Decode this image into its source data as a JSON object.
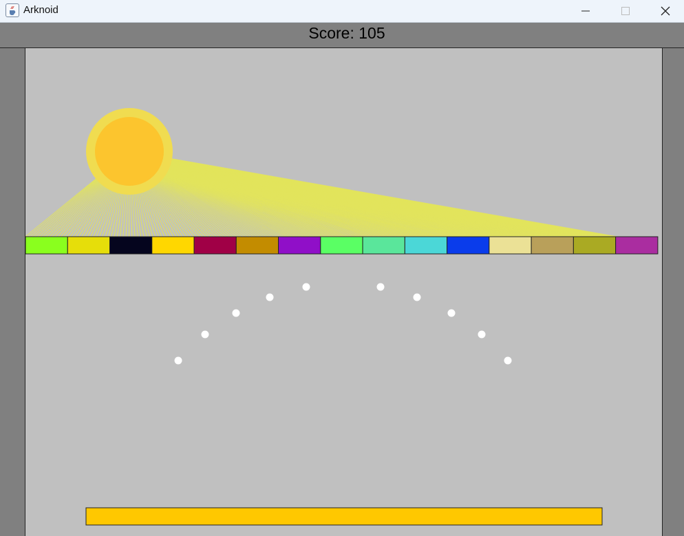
{
  "window": {
    "title": "Arknoid",
    "icon": "java-cup-icon",
    "buttons": [
      "minimize-icon",
      "maximize-icon",
      "close-icon"
    ]
  },
  "hud": {
    "score_text": "Score: 105"
  },
  "colors": {
    "border": "#808080",
    "field": "#c0c0c0",
    "sun_outer": "#f0dc50",
    "sun_inner": "#fcc52e",
    "rays": "#e2e45c",
    "ball": "#ffffff",
    "paddle": "#ffc800"
  },
  "bricks": [
    {
      "color": "#8aff1e"
    },
    {
      "color": "#e6de0a"
    },
    {
      "color": "#05051e"
    },
    {
      "color": "#ffd700"
    },
    {
      "color": "#a00046"
    },
    {
      "color": "#c38c00"
    },
    {
      "color": "#900fc8"
    },
    {
      "color": "#5aff64"
    },
    {
      "color": "#5ae69b"
    },
    {
      "color": "#4bd7d7"
    },
    {
      "color": "#0a3ceb"
    },
    {
      "color": "#ebe196"
    },
    {
      "color": "#b9a05a"
    },
    {
      "color": "#aaaa23"
    },
    {
      "color": "#aa2da0"
    }
  ],
  "balls_count": 10,
  "paddle": {
    "color": "#ffc800"
  }
}
